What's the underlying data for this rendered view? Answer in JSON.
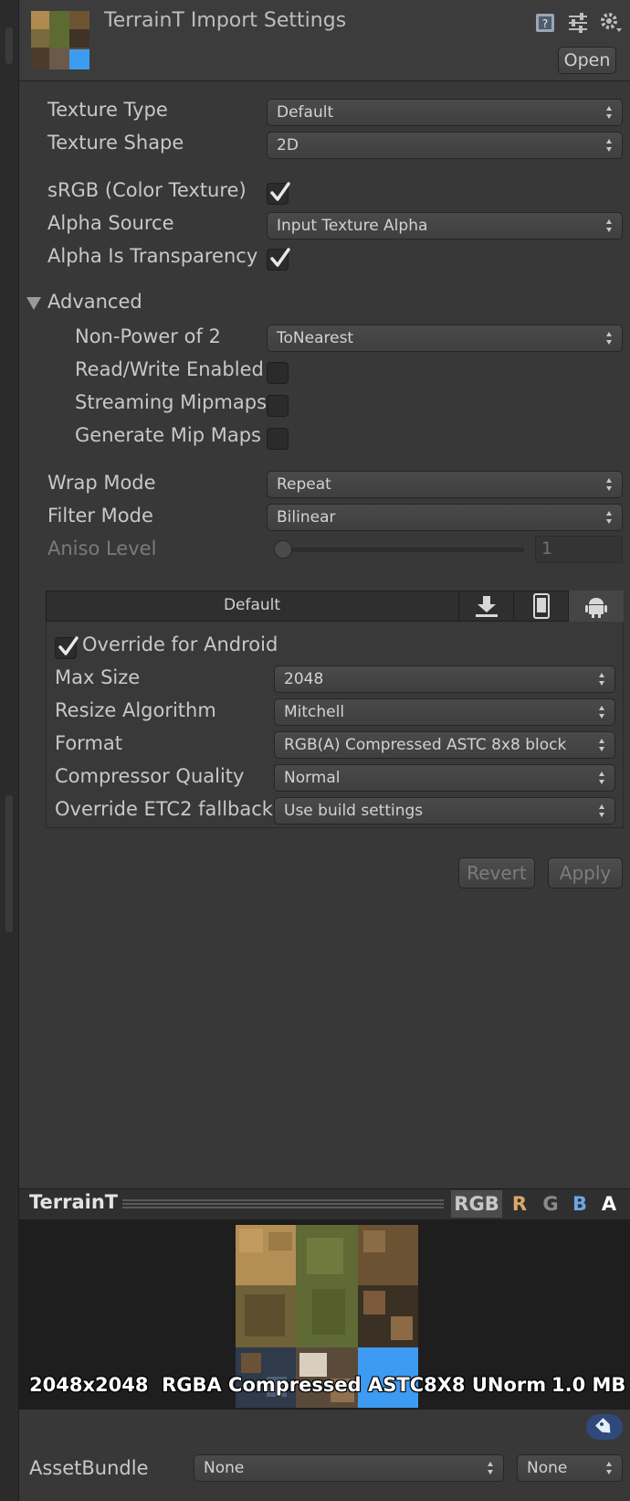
{
  "header": {
    "title": "TerrainT Import Settings",
    "open_label": "Open",
    "icons": [
      "help-book-icon",
      "sliders-icon",
      "gear-icon"
    ]
  },
  "settings": {
    "texture_type": {
      "label": "Texture Type",
      "value": "Default"
    },
    "texture_shape": {
      "label": "Texture Shape",
      "value": "2D"
    },
    "srgb": {
      "label": "sRGB (Color Texture)",
      "checked": true
    },
    "alpha_source": {
      "label": "Alpha Source",
      "value": "Input Texture Alpha"
    },
    "alpha_is_transparency": {
      "label": "Alpha Is Transparency",
      "checked": true
    }
  },
  "advanced": {
    "label": "Advanced",
    "non_power_of_2": {
      "label": "Non-Power of 2",
      "value": "ToNearest"
    },
    "read_write": {
      "label": "Read/Write Enabled",
      "checked": false
    },
    "streaming_mipmaps": {
      "label": "Streaming Mipmaps",
      "checked": false
    },
    "generate_mipmaps": {
      "label": "Generate Mip Maps",
      "checked": false
    }
  },
  "wrap_mode": {
    "label": "Wrap Mode",
    "value": "Repeat"
  },
  "filter_mode": {
    "label": "Filter Mode",
    "value": "Bilinear"
  },
  "aniso_level": {
    "label": "Aniso Level",
    "value": "1",
    "slider_fraction": 0.0
  },
  "platform": {
    "tabs": {
      "default_label": "Default",
      "icons": [
        "download-icon",
        "phone-icon",
        "android-icon"
      ]
    },
    "override": {
      "label": "Override for Android",
      "checked": true
    },
    "max_size": {
      "label": "Max Size",
      "value": "2048"
    },
    "resize_algorithm": {
      "label": "Resize Algorithm",
      "value": "Mitchell"
    },
    "format": {
      "label": "Format",
      "value": "RGB(A) Compressed ASTC 8x8 block"
    },
    "compressor_quality": {
      "label": "Compressor Quality",
      "value": "Normal"
    },
    "override_etc2": {
      "label": "Override ETC2 fallback",
      "value": "Use build settings"
    }
  },
  "actions": {
    "revert_label": "Revert",
    "apply_label": "Apply"
  },
  "preview": {
    "name": "TerrainT",
    "channels": [
      "RGB",
      "R",
      "G",
      "B",
      "A"
    ],
    "info_size": "2048x2048",
    "info_format": "RGBA Compressed ASTC8X8 UNorm",
    "info_filesize": "1.0 MB",
    "colors": {
      "r": "#d9a867",
      "g": "#8a8a8a",
      "b": "#6fa5e6",
      "a": "#ffffff",
      "rgb": "#c8c8c8"
    }
  },
  "assetbundle": {
    "label": "AssetBundle",
    "name_value": "None",
    "variant_value": "None"
  }
}
